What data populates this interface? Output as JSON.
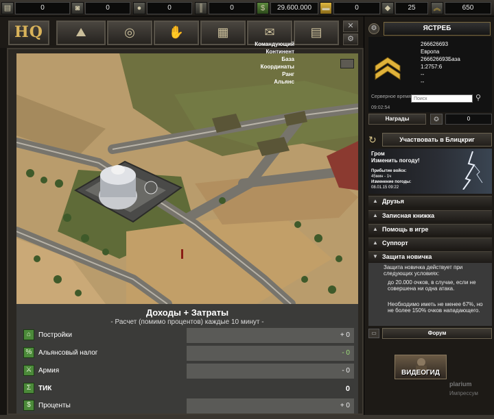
{
  "resources": [
    {
      "icon": "gold-bars-icon",
      "value": "0"
    },
    {
      "icon": "oil-barrels-icon",
      "value": "0"
    },
    {
      "icon": "ore-icon",
      "value": "0"
    },
    {
      "icon": "ammo-icon",
      "value": "0"
    },
    {
      "icon": "money-icon",
      "value": "29.600.000"
    },
    {
      "icon": "fuel-icon",
      "value": "0"
    },
    {
      "icon": "diamond-icon",
      "value": "25"
    },
    {
      "icon": "rank-chevron-icon",
      "value": "650"
    }
  ],
  "nav": {
    "hq_label": "HQ",
    "items": [
      {
        "icon": "map-icon"
      },
      {
        "icon": "globe-icon"
      },
      {
        "icon": "handshake-icon"
      },
      {
        "icon": "documents-icon"
      },
      {
        "icon": "envelope-icon"
      },
      {
        "icon": "newspaper-icon"
      }
    ],
    "close_icon": "✕",
    "gear_icon": "⚙"
  },
  "finance": {
    "title": "Доходы + Затраты",
    "subtitle": "- Расчет (помимо процентов) каждые 10 минут -",
    "rows": [
      {
        "label": "Постройки",
        "value": "+ 0",
        "style": "normal"
      },
      {
        "label": "Альянсовый налог",
        "value": "- 0",
        "style": "green"
      },
      {
        "label": "Армия",
        "value": "- 0",
        "style": "normal"
      },
      {
        "label": "ТИК",
        "value": "0",
        "style": "bold"
      },
      {
        "label": "Проценты",
        "value": "+ 0",
        "style": "normal"
      }
    ]
  },
  "profile": {
    "name": "ЯСТРЕБ",
    "fields": [
      {
        "key": "Командующий",
        "value": "266626693"
      },
      {
        "key": "Континент",
        "value": "Европа"
      },
      {
        "key": "База",
        "value": "266626693База"
      },
      {
        "key": "Координаты",
        "value": "1:2757:6"
      },
      {
        "key": "Ранг",
        "value": "--"
      },
      {
        "key": "Альянс",
        "value": "--"
      }
    ],
    "server_time_label": "Серверное время:",
    "server_time": "09:02:54",
    "search_placeholder": "Поиск",
    "awards_label": "Награды",
    "awards_count": "0"
  },
  "blitz": {
    "button": "Участвовать в Блицкриг",
    "player": "Гром",
    "change_weather": "Изменить погоду!",
    "arrival_label": "Прибытие войск:",
    "arrival_value": "45мин - 1ч",
    "weather_change_label": "Изменение погоды:",
    "weather_change_value": "08.01.15 09:22"
  },
  "accordion": [
    {
      "label": "Друзья",
      "arrow": "▲"
    },
    {
      "label": "Записная книжка",
      "arrow": "▲"
    },
    {
      "label": "Помощь в игре",
      "arrow": "▲"
    },
    {
      "label": "Суппорт",
      "arrow": "▲"
    },
    {
      "label": "Защита новичка",
      "arrow": "▼"
    }
  ],
  "newbie": {
    "intro": "Защита новичка действует при следующих условиях:",
    "cond1": "до 20.000 очков, в случае, если не совершена ни одна атака.",
    "cond2": "Необходимо иметь не менее 67%, но не более 150% очков нападающего."
  },
  "forum_label": "Форум",
  "video_label": "ВИДЕОГИД",
  "brand": "plarium",
  "impressum": "Импрессум"
}
